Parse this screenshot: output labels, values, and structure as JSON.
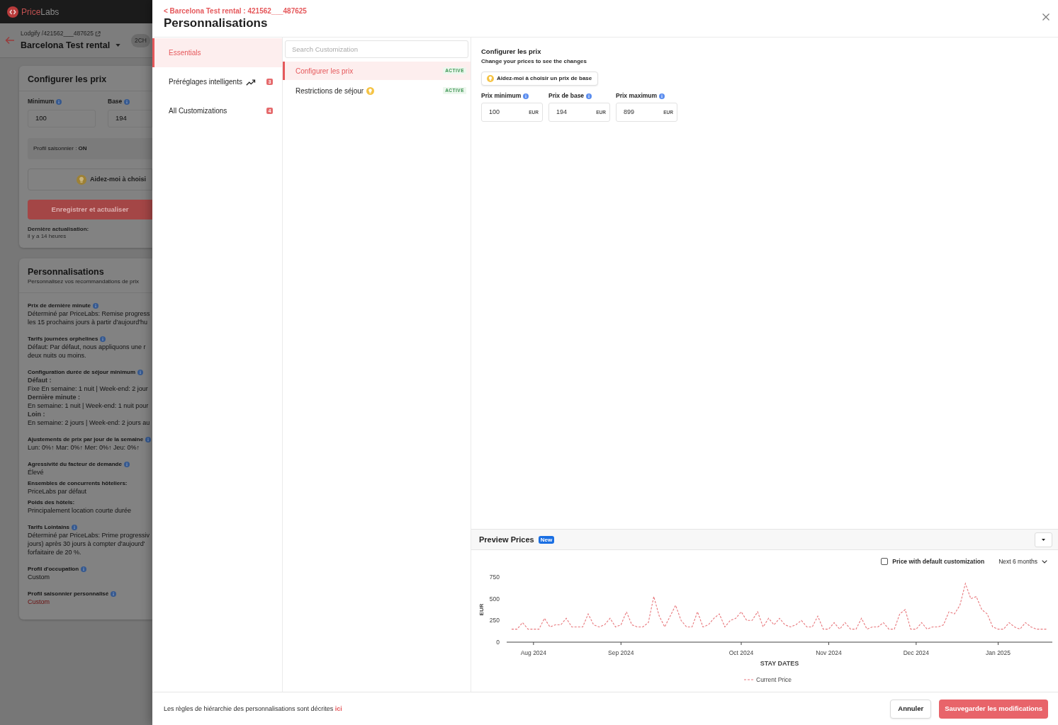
{
  "background_page": {
    "logo": {
      "accent": "Price",
      "text": "Labs"
    },
    "breadcrumb": "Lodgify /421562___487625",
    "listing_name": "Barcelona Test rental",
    "tag": "2CH",
    "price_card": {
      "title": "Configurer les prix",
      "fields": [
        {
          "label": "Minimum",
          "value": "100"
        },
        {
          "label": "Base",
          "value": "194"
        }
      ],
      "seasonal_profile": "Profil saisonnier : **ON**",
      "help_button": "Aidez-moi à choisi",
      "save_button": "Enregistrer et actualiser",
      "last_update_label": "Dernière actualisation:",
      "last_update_value": "il y a 14 heures"
    },
    "customizations_card": {
      "title": "Personnalisations",
      "subtitle": "Personnalisez vos recommandations de prix",
      "sections": [
        {
          "title": "Prix de dernière minute",
          "info": true,
          "lines": [
            {
              "kind": "text",
              "text": "Déterminé par PriceLabs: Remise progress"
            },
            {
              "kind": "text",
              "text": "les 15 prochains jours à partir d'aujourd'hu"
            }
          ]
        },
        {
          "title": "Tarifs journées orphelines",
          "info": true,
          "lines": [
            {
              "kind": "text",
              "text": "Défaut: Par défaut, nous appliquons une r"
            },
            {
              "kind": "text",
              "text": "deux nuits ou moins."
            }
          ]
        },
        {
          "title": "Configuration durée de séjour minimum",
          "info": true,
          "lines": [
            {
              "kind": "sublabel",
              "text": "Défaut :"
            },
            {
              "kind": "text",
              "text": "Fixe En semaine: 1 nuit | Week-end: 2 jour"
            },
            {
              "kind": "sublabel",
              "text": "Dernière minute :"
            },
            {
              "kind": "text",
              "text": "En semaine: 1 nuit | Week-end: 1 nuit pour"
            },
            {
              "kind": "sublabel",
              "text": "Loin :"
            },
            {
              "kind": "text",
              "text": "En semaine: 2 jours | Week-end: 2 jours au"
            }
          ]
        },
        {
          "title": "Ajustements de prix par jour de la semaine",
          "info": true,
          "lines": [
            {
              "kind": "text",
              "text": "Lun: 0%↑ Mar: 0%↑ Mer: 0%↑ Jeu: 0%↑"
            }
          ]
        },
        {
          "title": "Agressivité du facteur de demande",
          "info": true,
          "lines": [
            {
              "kind": "text",
              "text": "Élevé"
            }
          ]
        },
        {
          "title": "Ensembles de concurrents hôteliers:",
          "info": false,
          "lines": [
            {
              "kind": "text",
              "text": "PriceLabs par défaut"
            }
          ]
        },
        {
          "title": "Poids des hôtels:",
          "info": false,
          "lines": [
            {
              "kind": "text",
              "text": "Principalement location courte durée"
            }
          ]
        },
        {
          "title": "Tarifs Lointains",
          "info": true,
          "lines": [
            {
              "kind": "text",
              "text": "Déterminé par PriceLabs: Prime progressiv"
            },
            {
              "kind": "text",
              "text": "jours) après 30 jours à compter d'aujourd'"
            },
            {
              "kind": "text",
              "text": "forfaitaire de 20 %."
            }
          ]
        },
        {
          "title": "Profil d'occupation",
          "info": true,
          "lines": [
            {
              "kind": "text",
              "text": "Custom"
            }
          ]
        },
        {
          "title": "Profil saisonnier personnalisé",
          "info": true,
          "lines": [
            {
              "kind": "link",
              "text": "Custom"
            }
          ]
        }
      ]
    }
  },
  "modal": {
    "breadcrumb": "< Barcelona Test rental : 421562___487625",
    "title": "Personnalisations",
    "categories": [
      {
        "label": "Essentials",
        "selected": true,
        "has_icon": false
      },
      {
        "label": "Préréglages intelligents",
        "selected": false,
        "has_icon": true,
        "count": "3"
      },
      {
        "label": "All Customizations",
        "selected": false,
        "has_icon": false,
        "count": "4"
      }
    ],
    "search": {
      "placeholder": "Search Customization"
    },
    "customizations": [
      {
        "label": "Configurer les prix",
        "selected": true,
        "has_icon": false,
        "status": "ACTIVE"
      },
      {
        "label": "Restrictions de séjour",
        "selected": false,
        "has_icon": true,
        "status": "ACTIVE"
      }
    ],
    "editor": {
      "title": "Configurer les prix",
      "subtitle": "Change your prices to see the changes",
      "help_button": "Aidez-moi à choisir un prix de base",
      "fields": [
        {
          "label": "Prix minimum",
          "value": "100",
          "unit": "EUR"
        },
        {
          "label": "Prix de base",
          "value": "194",
          "unit": "EUR"
        },
        {
          "label": "Prix maximum",
          "value": "899",
          "unit": "EUR"
        }
      ]
    },
    "preview": {
      "title": "Preview Prices",
      "badge": "New",
      "checkbox": {
        "label": "Price with default customization",
        "checked": false
      },
      "range": "Next 6 months",
      "chart_data": {
        "type": "line",
        "xlabel": "STAY DATES",
        "ylabel": "EUR",
        "categories": [
          null,
          null,
          null,
          null,
          "Aug 2024",
          null,
          null,
          null,
          null,
          null,
          null,
          null,
          null,
          null,
          null,
          null,
          null,
          null,
          null,
          null,
          "Sep 2024",
          null,
          null,
          null,
          null,
          null,
          null,
          null,
          null,
          null,
          null,
          null,
          null,
          null,
          null,
          null,
          null,
          null,
          null,
          null,
          null,
          null,
          "Oct 2024",
          null,
          null,
          null,
          null,
          null,
          null,
          null,
          null,
          null,
          null,
          null,
          null,
          null,
          null,
          null,
          "Nov 2024",
          null,
          null,
          null,
          null,
          null,
          null,
          null,
          null,
          null,
          null,
          null,
          null,
          null,
          null,
          null,
          "Dec 2024",
          null,
          null,
          null,
          null,
          null,
          null,
          null,
          null,
          null,
          null,
          null,
          null,
          null,
          null,
          "Jan 2025",
          null,
          null,
          null,
          null,
          null,
          null,
          null,
          null,
          null
        ],
        "series": [
          {
            "name": "Current Price",
            "color": "#e8777c",
            "line_style": "dashed",
            "values": [
              150,
              150,
              225,
              150,
              150,
              150,
              275,
              175,
              200,
              200,
              275,
              175,
              175,
              175,
              325,
              200,
              175,
              200,
              275,
              175,
              200,
              350,
              200,
              175,
              175,
              225,
              525,
              300,
              175,
              300,
              425,
              250,
              175,
              175,
              350,
              175,
              200,
              275,
              325,
              175,
              250,
              275,
              350,
              250,
              250,
              350,
              175,
              275,
              200,
              275,
              200,
              175,
              200,
              250,
              175,
              175,
              300,
              150,
              150,
              225,
              150,
              225,
              150,
              150,
              275,
              150,
              175,
              175,
              225,
              150,
              150,
              325,
              375,
              150,
              150,
              225,
              150,
              175,
              175,
              200,
              350,
              325,
              425,
              675,
              500,
              525,
              375,
              325,
              175,
              150,
              150,
              225,
              175,
              150,
              225,
              175,
              150,
              150,
              150
            ]
          }
        ],
        "ylim": [
          0,
          750
        ],
        "yticks": [
          0,
          250,
          500,
          750
        ]
      }
    },
    "footer": {
      "text": "Les règles de hiérarchie des personnalisations sont décrites",
      "link": "ici",
      "buttons": [
        {
          "label": "Annuler",
          "kind": "secondary"
        },
        {
          "label": "Sauvegarder les modifications",
          "kind": "primary"
        }
      ]
    }
  }
}
